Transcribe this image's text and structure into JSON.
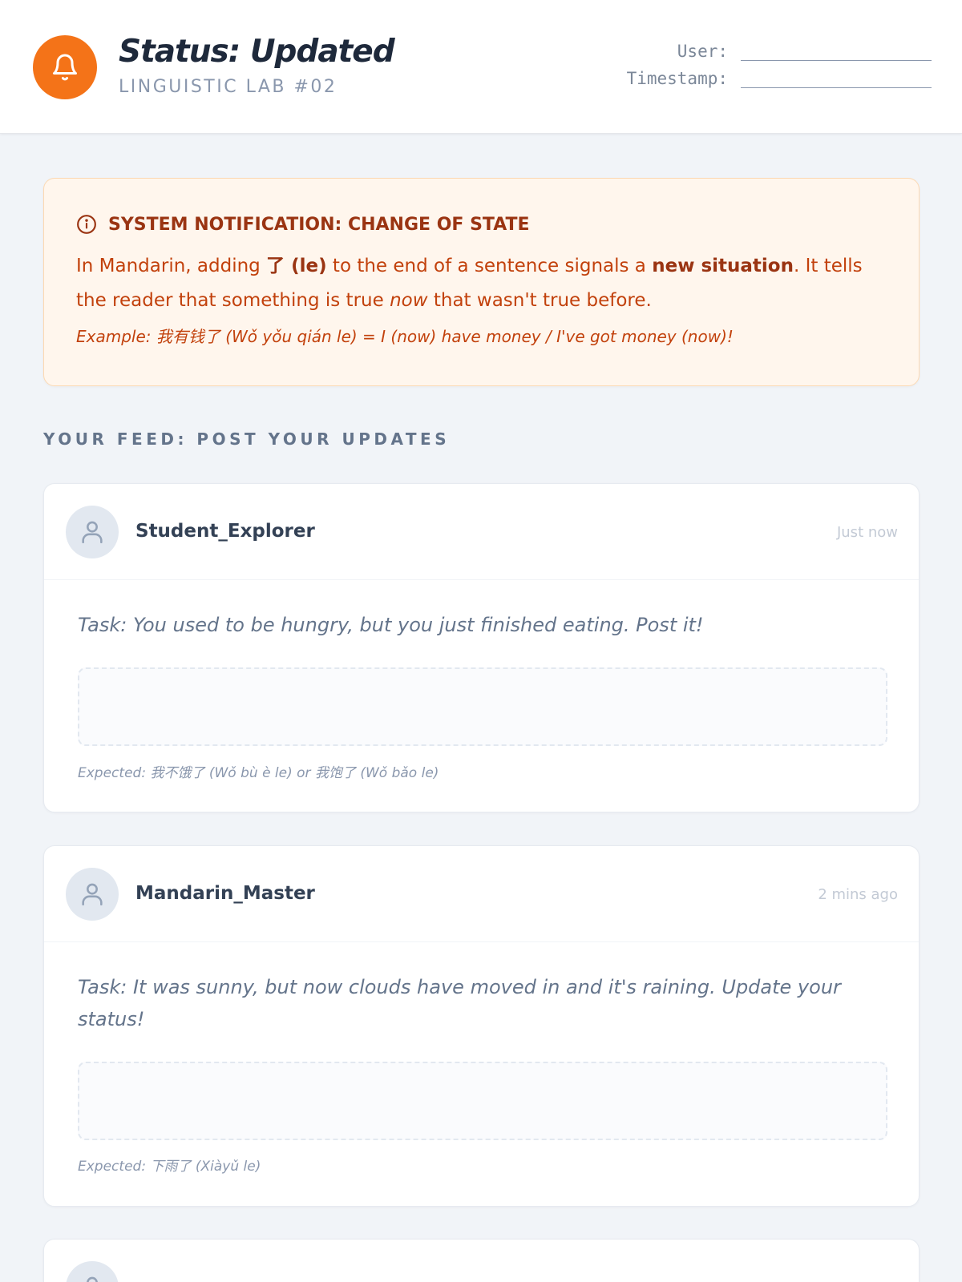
{
  "header": {
    "title": "Status: Updated",
    "subtitle": "LINGUISTIC LAB #02",
    "user_label": "User:",
    "timestamp_label": "Timestamp:",
    "icon": "bell-icon",
    "accent_color": "#f47318"
  },
  "notice": {
    "icon": "info-icon",
    "title": "SYSTEM NOTIFICATION: CHANGE OF STATE",
    "body_1": "In Mandarin, adding ",
    "body_particle": "了 (le)",
    "body_2": " to the end of a sentence signals a ",
    "body_bold": "new situation",
    "body_3": ". It tells the reader that something is true ",
    "body_now": "now",
    "body_4": " that wasn't true before.",
    "example": "Example: 我有钱了 (Wǒ yǒu qián le) = I (now) have money / I've got money (now)!"
  },
  "feed": {
    "heading": "YOUR FEED: POST YOUR UPDATES",
    "posts": [
      {
        "username": "Student_Explorer",
        "time": "Just now",
        "task": "Task: You used to be hungry, but you just finished eating. Post it!",
        "answer": "",
        "expected": "Expected: 我不饿了 (Wǒ bù è le) or 我饱了 (Wǒ bǎo le)"
      },
      {
        "username": "Mandarin_Master",
        "time": "2 mins ago",
        "task": "Task: It was sunny, but now clouds have moved in and it's raining. Update your status!",
        "answer": "",
        "expected": "Expected: 下雨了 (Xiàyǔ le)"
      }
    ]
  }
}
